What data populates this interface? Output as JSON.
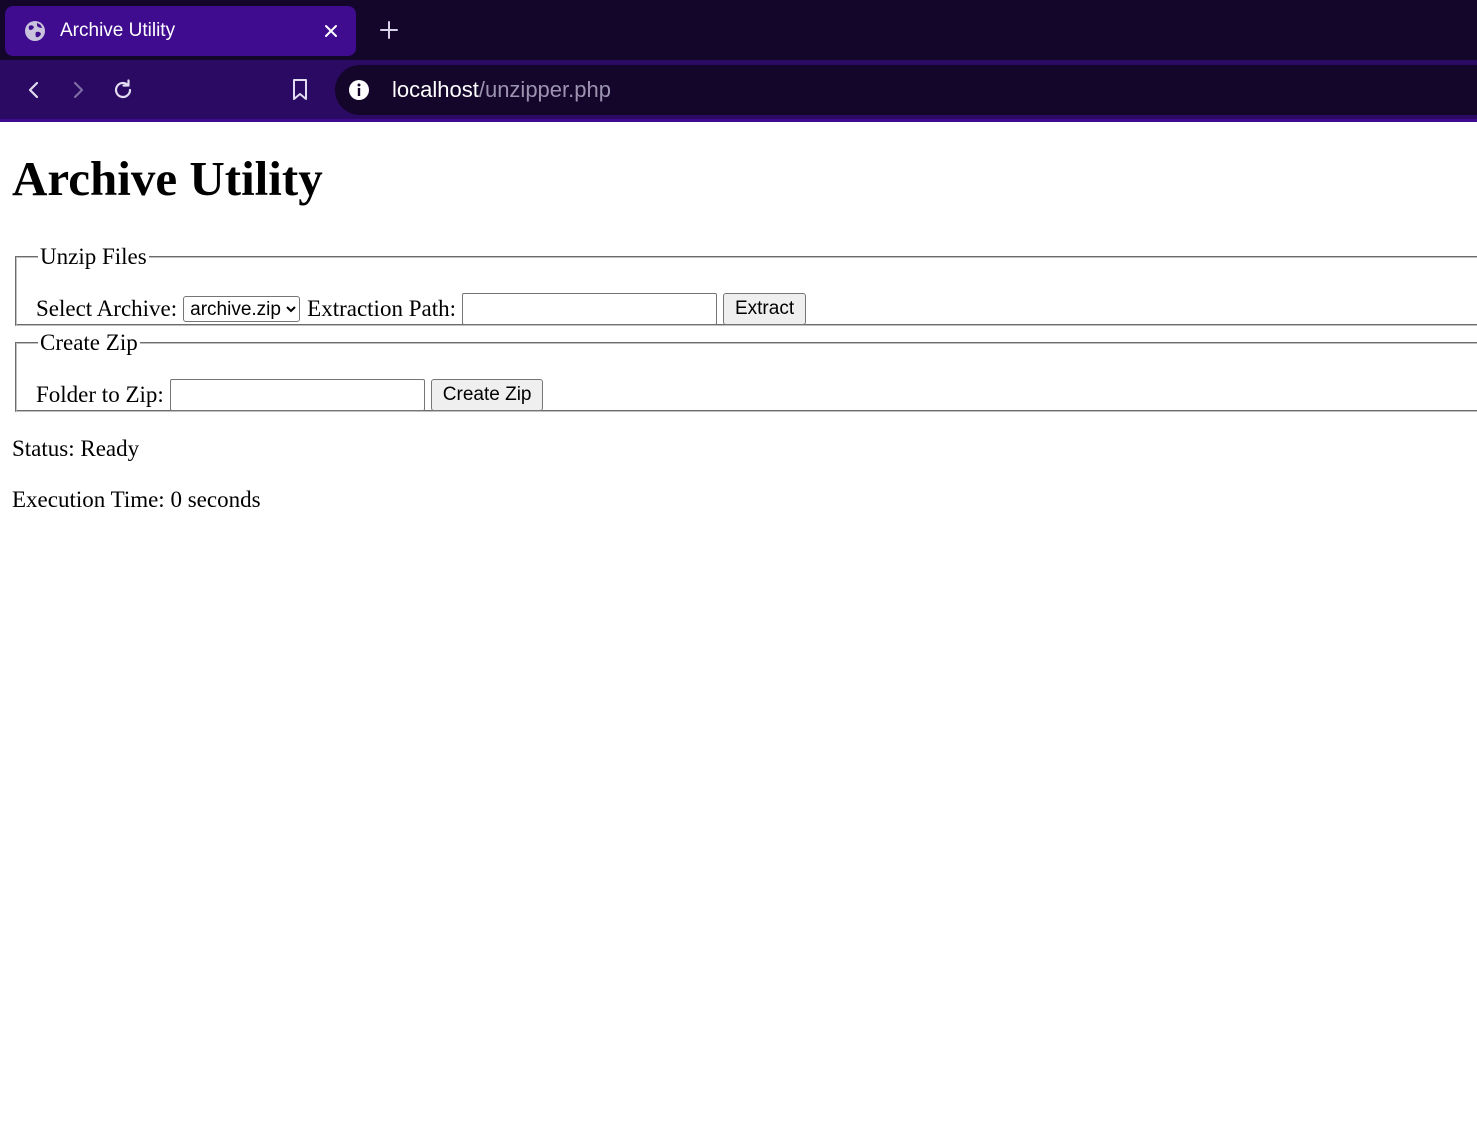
{
  "browser": {
    "tab": {
      "title": "Archive Utility",
      "icon": "globe-icon"
    },
    "toolbar": {
      "url_host": "localhost",
      "url_path": "/unzipper.php"
    }
  },
  "page": {
    "heading": "Archive Utility",
    "unzip": {
      "legend": "Unzip Files",
      "select_label": "Select Archive:",
      "select_value": "archive.zip",
      "path_label": "Extraction Path:",
      "path_value": "",
      "button": "Extract"
    },
    "create": {
      "legend": "Create Zip",
      "folder_label": "Folder to Zip:",
      "folder_value": "",
      "button": "Create Zip"
    },
    "status_text": "Status: Ready",
    "time_text": "Execution Time: 0 seconds"
  },
  "colors": {
    "tabstrip": "#14052a",
    "active_tab": "#3f0c8f",
    "toolbar": "#2b0a63"
  }
}
